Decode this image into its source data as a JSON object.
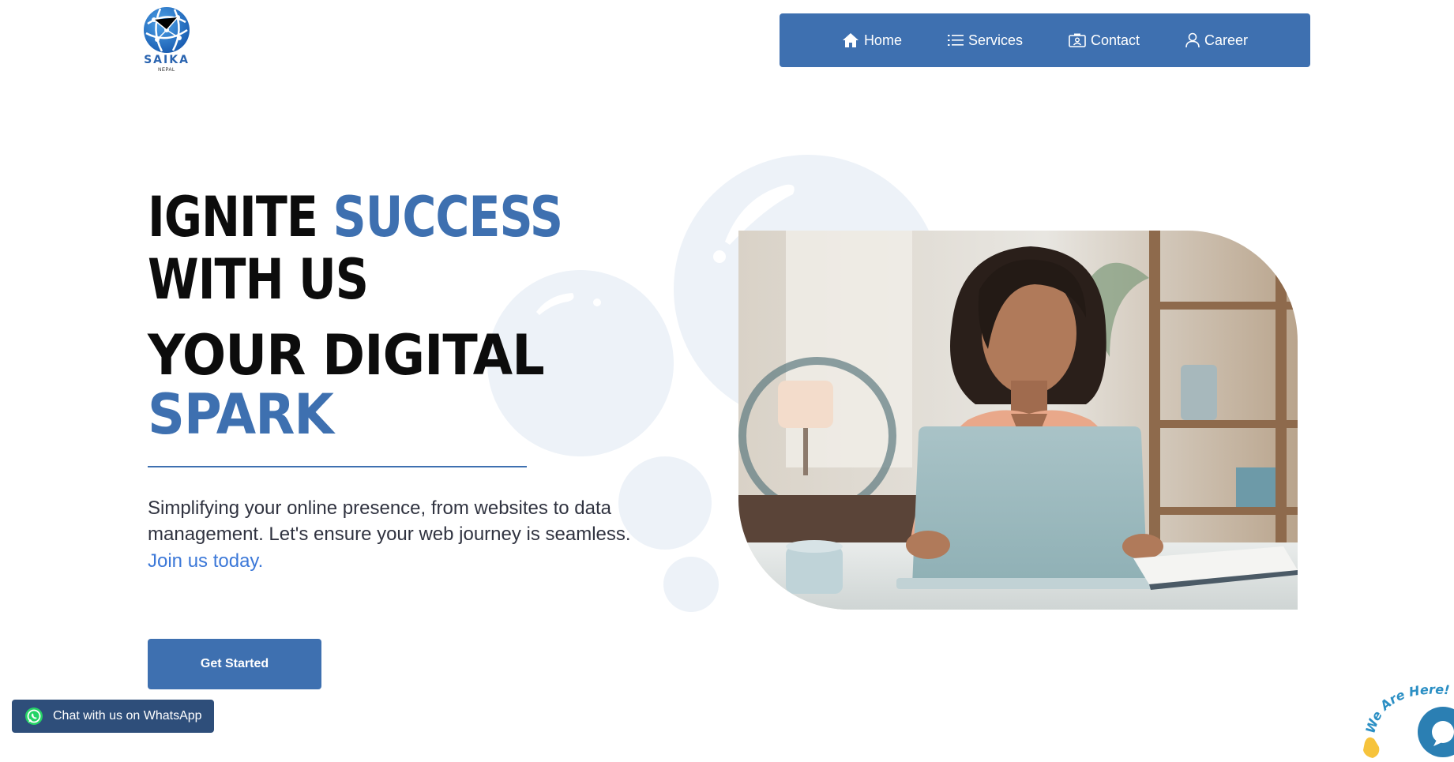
{
  "logo": {
    "name": "SAIKA",
    "sub": "NEPAL"
  },
  "nav": {
    "items": [
      {
        "label": "Home",
        "icon": "home-icon"
      },
      {
        "label": "Services",
        "icon": "list-icon"
      },
      {
        "label": "Contact",
        "icon": "contact-card-icon"
      },
      {
        "label": "Career",
        "icon": "user-icon"
      }
    ]
  },
  "hero": {
    "line1_a": "IGNITE ",
    "line1_b": "SUCCESS",
    "line2": "WITH US",
    "line3": "YOUR DIGITAL",
    "line4": "SPARK",
    "description": "Simplifying your online presence, from websites to data management. Let's ensure your web journey is seamless.",
    "join": "Join us today.",
    "cta": "Get Started"
  },
  "whatsapp": {
    "label": "Chat with us on WhatsApp"
  },
  "chat_widget": {
    "tagline": "We Are Here!"
  },
  "colors": {
    "brand": "#3e70b0",
    "link": "#3c78d8",
    "whatsapp_chip": "#2e4e7a",
    "bubble": "#edf2f8"
  }
}
